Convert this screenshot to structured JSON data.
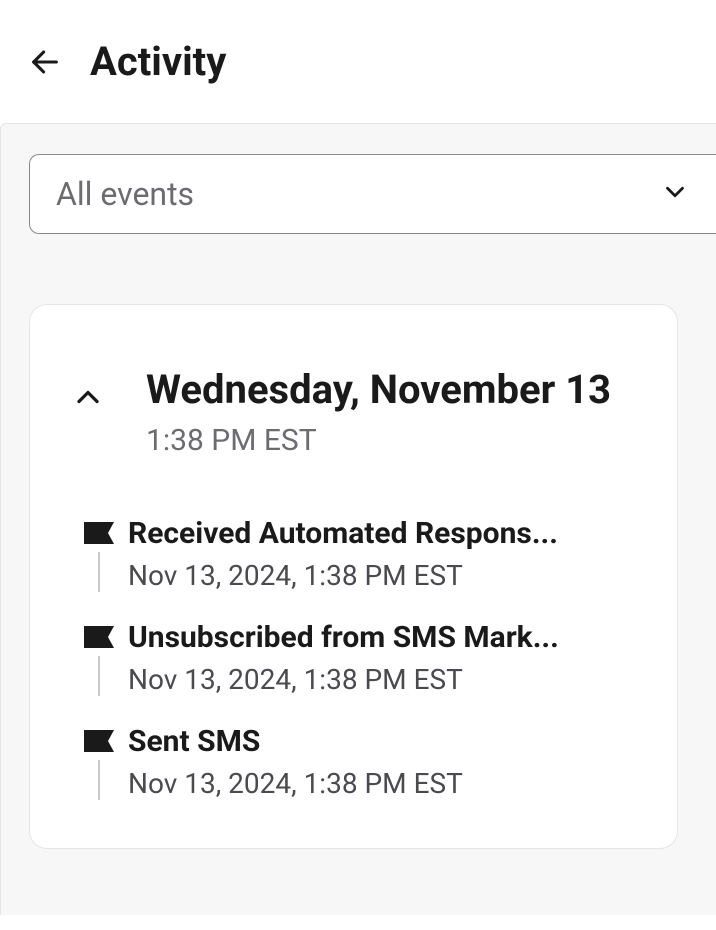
{
  "header": {
    "title": "Activity"
  },
  "filter": {
    "selected_label": "All events"
  },
  "activity": {
    "date_group": {
      "date_label": "Wednesday, November 13",
      "time_label": "1:38 PM EST",
      "events": [
        {
          "title": "Received Automated Respons...",
          "timestamp": "Nov 13, 2024, 1:38 PM EST"
        },
        {
          "title": "Unsubscribed from SMS Mark...",
          "timestamp": "Nov 13, 2024, 1:38 PM EST"
        },
        {
          "title": "Sent SMS",
          "timestamp": "Nov 13, 2024, 1:38 PM EST"
        }
      ]
    }
  }
}
